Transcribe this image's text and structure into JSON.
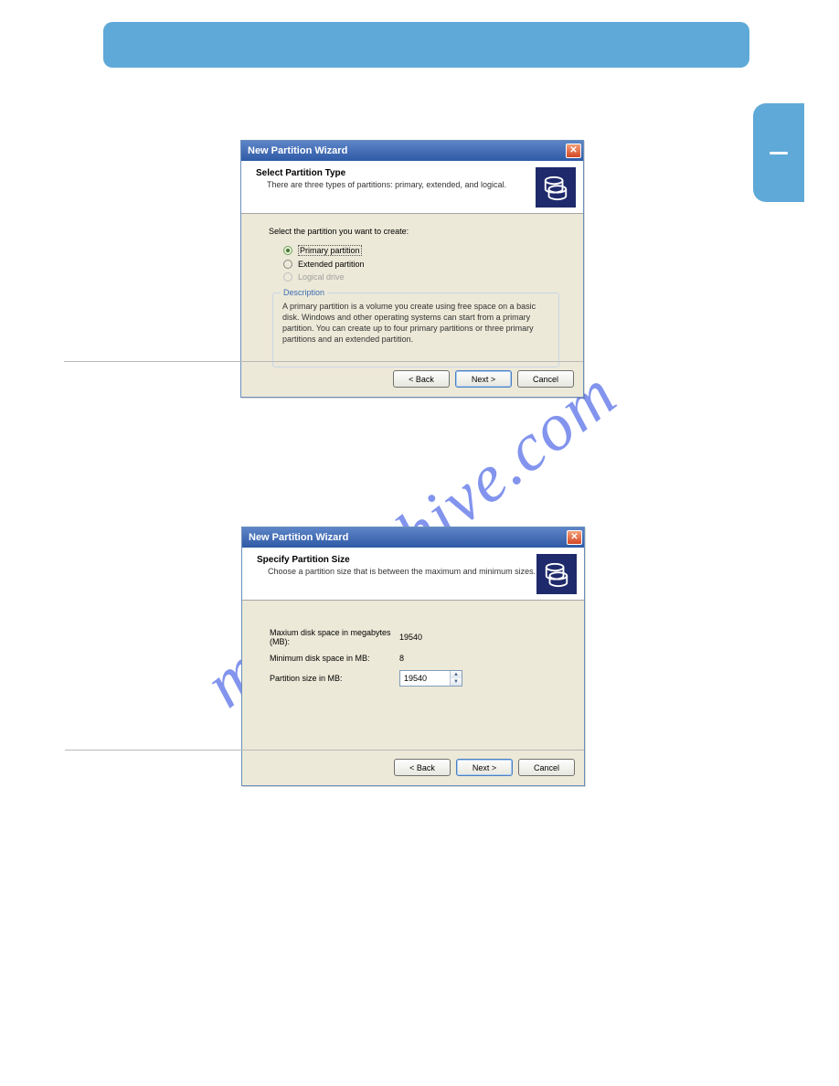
{
  "watermark": "manualshive.com",
  "dialog1": {
    "title": "New Partition Wizard",
    "close_glyph": "✕",
    "banner_title": "Select Partition Type",
    "banner_sub": "There are three types of partitions: primary, extended, and logical.",
    "prompt": "Select the partition you want to create:",
    "options": {
      "opt1": "Primary partition",
      "opt2": "Extended partition",
      "opt3": "Logical drive"
    },
    "fieldset_legend": "Description",
    "description": "A primary partition is a volume you create using free space on a basic disk. Windows and other operating systems can start from a primary partition. You can create up to four primary partitions or three primary partitions and an extended partition.",
    "buttons": {
      "back": "< Back",
      "next": "Next >",
      "cancel": "Cancel"
    }
  },
  "dialog2": {
    "title": "New Partition Wizard",
    "close_glyph": "✕",
    "banner_title": "Specify Partition Size",
    "banner_sub": "Choose a partition size that is between the maximum and minimum sizes.",
    "rows": {
      "max_label": "Maxium disk space in megabytes (MB):",
      "max_value": "19540",
      "min_label": "Minimum disk space in MB:",
      "min_value": "8",
      "size_label": "Partition size in MB:",
      "size_value": "19540"
    },
    "spin_up": "▲",
    "spin_down": "▼",
    "buttons": {
      "back": "< Back",
      "next": "Next >",
      "cancel": "Cancel"
    }
  }
}
